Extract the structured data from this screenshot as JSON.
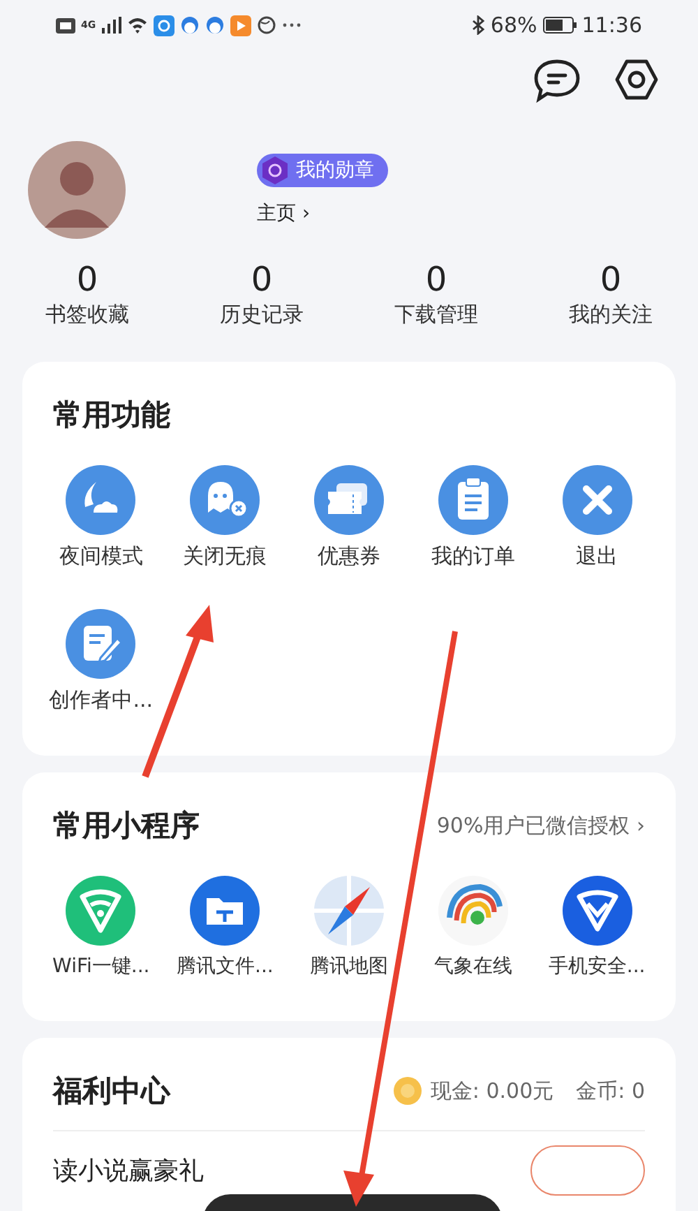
{
  "status_bar": {
    "network": "4G",
    "battery": "68%",
    "time": "11:36"
  },
  "profile": {
    "badge": "我的勋章",
    "home_link": "主页 ›"
  },
  "stats": [
    {
      "value": "0",
      "label": "书签收藏"
    },
    {
      "value": "0",
      "label": "历史记录"
    },
    {
      "value": "0",
      "label": "下载管理"
    },
    {
      "value": "0",
      "label": "我的关注"
    }
  ],
  "functions": {
    "title": "常用功能",
    "items": [
      {
        "label": "夜间模式"
      },
      {
        "label": "关闭无痕"
      },
      {
        "label": "优惠券"
      },
      {
        "label": "我的订单"
      },
      {
        "label": "退出"
      },
      {
        "label": "创作者中..."
      }
    ]
  },
  "mini_programs": {
    "title": "常用小程序",
    "note": "90%用户已微信授权 ›",
    "items": [
      {
        "label": "WiFi一键..."
      },
      {
        "label": "腾讯文件..."
      },
      {
        "label": "腾讯地图"
      },
      {
        "label": "气象在线"
      },
      {
        "label": "手机安全..."
      }
    ]
  },
  "welfare": {
    "title": "福利中心",
    "cash": "现金: 0.00元",
    "coins": "金币: 0",
    "task": "读小说赢豪礼"
  }
}
